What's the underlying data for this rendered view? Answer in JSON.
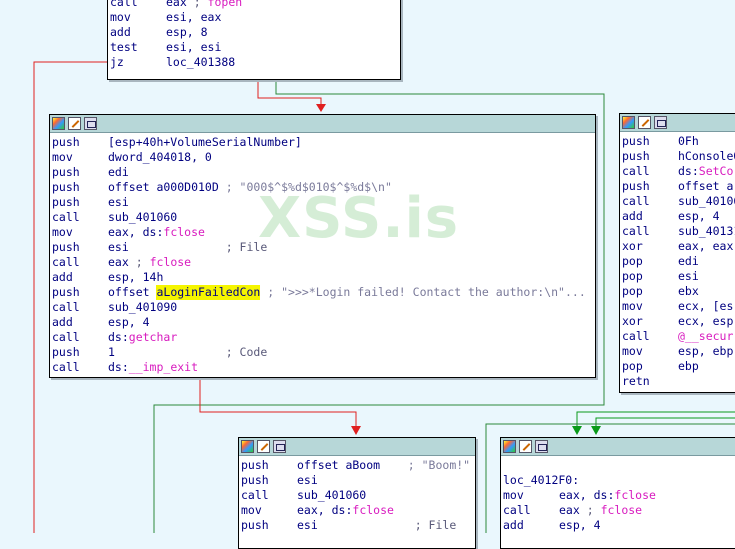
{
  "watermark": "XSS.is",
  "colors": {
    "background": "#eaf7fd",
    "false_edge": "#e02020",
    "true_edge": "#0a9a1a",
    "plain_edge": "#2c8a3a"
  },
  "nodes": {
    "top": {
      "lines": [
        {
          "mn": "call",
          "op": "eax",
          "cm": " ; ",
          "fn": "fopen"
        },
        {
          "mn": "mov",
          "op": "esi, eax"
        },
        {
          "mn": "add",
          "op": "esp, 8"
        },
        {
          "mn": "test",
          "op": "esi, esi"
        },
        {
          "mn": "jz",
          "op": "loc_401388"
        }
      ]
    },
    "middle": {
      "lines": [
        {
          "mn": "push",
          "op": "[esp+40h+VolumeSerialNumber]"
        },
        {
          "mn": "mov",
          "op": "dword_404018, 0"
        },
        {
          "mn": "push",
          "op": "edi"
        },
        {
          "mn": "push",
          "op": "offset a000D010D",
          "cm": " ; \"000$^$%d$010$^$%d$\\n\""
        },
        {
          "mn": "push",
          "op": "esi"
        },
        {
          "mn": "call",
          "op": "sub_401060"
        },
        {
          "mn": "mov",
          "op": "eax, ds:",
          "fn": "fclose"
        },
        {
          "mn": "push",
          "op": "esi",
          "cm": "              ; File"
        },
        {
          "mn": "call",
          "op": "eax",
          "cm": " ; ",
          "fn": "fclose"
        },
        {
          "mn": "add",
          "op": "esp, 14h"
        },
        {
          "mn": "push",
          "op": "offset ",
          "hl": "aLoginFailedCon",
          "cm": " ; \">>>*Login failed! Contact the author:\\n\"..."
        },
        {
          "mn": "call",
          "op": "sub_401090"
        },
        {
          "mn": "add",
          "op": "esp, 4"
        },
        {
          "mn": "call",
          "op": "ds:",
          "fn": "getchar"
        },
        {
          "mn": "push",
          "op": "1",
          "cm": "                ; Code"
        },
        {
          "mn": "call",
          "op": "ds:",
          "fn": "__imp_exit"
        }
      ]
    },
    "right": {
      "lines": [
        {
          "mn": "push",
          "op": "0Fh"
        },
        {
          "mn": "push",
          "op": "hConsoleO"
        },
        {
          "mn": "call",
          "op": "ds:",
          "fn": "SetCo"
        },
        {
          "mn": "push",
          "op": "offset a"
        },
        {
          "mn": "call",
          "op": "sub_40106"
        },
        {
          "mn": "add",
          "op": "esp, 4"
        },
        {
          "mn": "call",
          "op": "sub_40131"
        },
        {
          "mn": "xor",
          "op": "eax, eax"
        },
        {
          "mn": "pop",
          "op": "edi"
        },
        {
          "mn": "pop",
          "op": "esi"
        },
        {
          "mn": "pop",
          "op": "ebx"
        },
        {
          "mn": "mov",
          "op": "ecx, [es"
        },
        {
          "mn": "xor",
          "op": "ecx, esp"
        },
        {
          "mn": "call",
          "op": "",
          "fn": "@__secur"
        },
        {
          "mn": "mov",
          "op": "esp, ebp"
        },
        {
          "mn": "pop",
          "op": "ebp"
        },
        {
          "mn": "retn",
          "op": ""
        }
      ]
    },
    "boom": {
      "lines": [
        {
          "mn": "push",
          "op": "offset aBoom",
          "cm": "    ; \"Boom!\""
        },
        {
          "mn": "push",
          "op": "esi"
        },
        {
          "mn": "call",
          "op": "sub_401060"
        },
        {
          "mn": "mov",
          "op": "eax, ds:",
          "fn": "fclose"
        },
        {
          "mn": "push",
          "op": "esi",
          "cm": "              ; File"
        }
      ]
    },
    "loc": {
      "lines": [
        {
          "mn": "",
          "op": ""
        },
        {
          "mn": "loc_4012F0:",
          "op": ""
        },
        {
          "mn": "mov",
          "op": "eax, ds:",
          "fn": "fclose"
        },
        {
          "mn": "call",
          "op": "eax",
          "cm": " ; ",
          "fn": "fclose"
        },
        {
          "mn": "add",
          "op": "esp, 4"
        }
      ]
    }
  }
}
